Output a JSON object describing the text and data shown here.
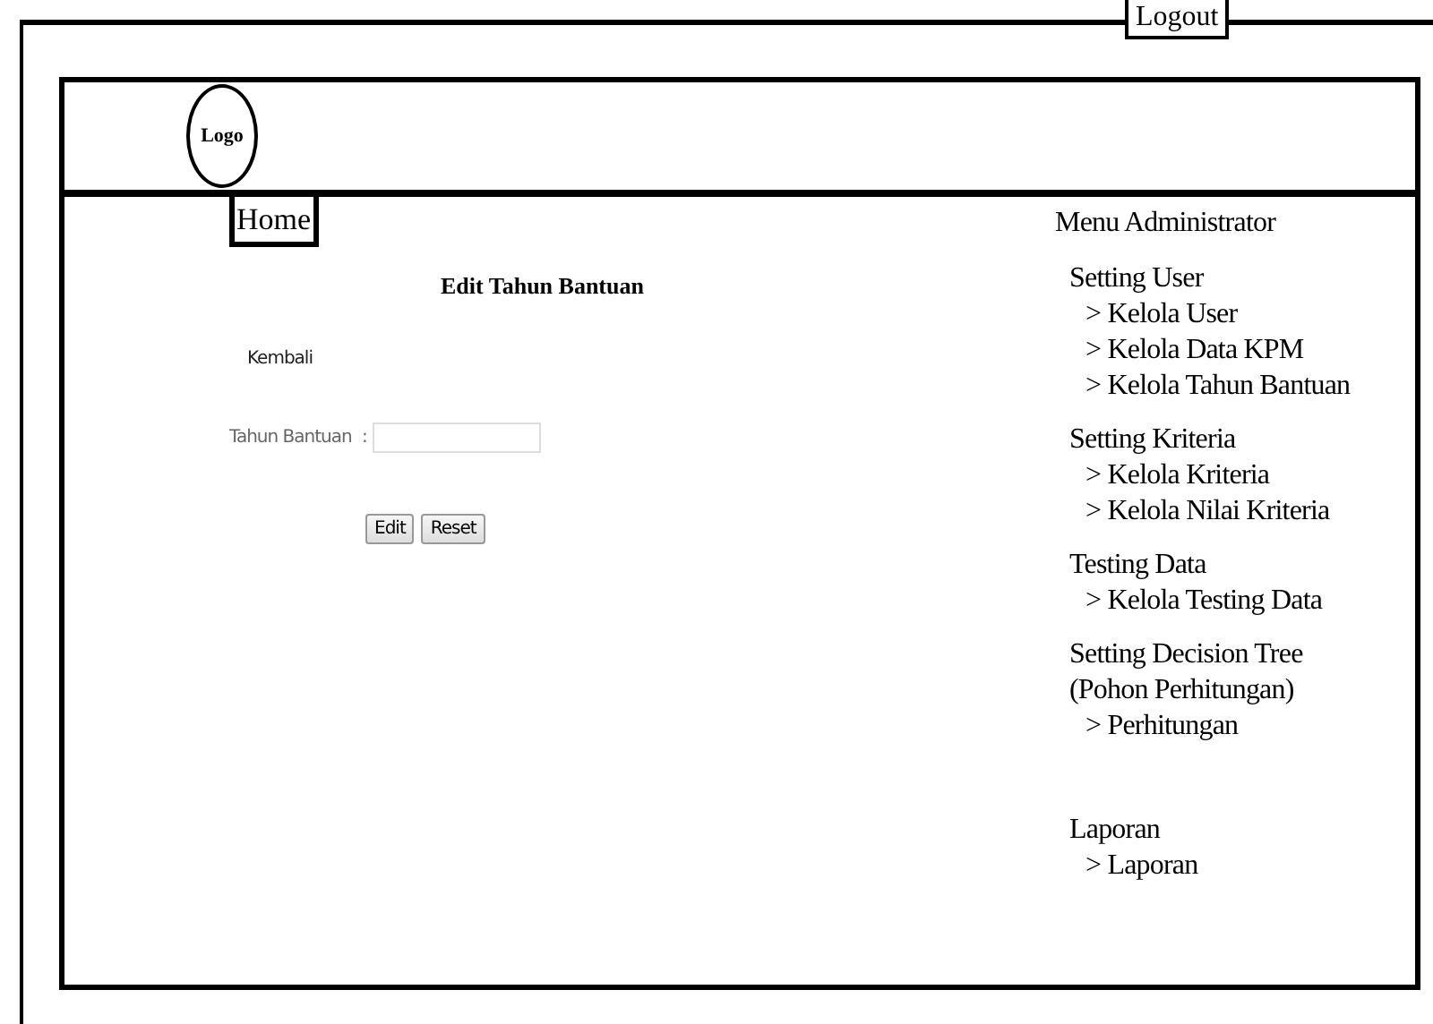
{
  "logout": "Logout",
  "logo": "Logo",
  "home": "Home",
  "form": {
    "title": "Edit Tahun Bantuan",
    "back_link": "Kembali",
    "fields": [
      {
        "label": "Tahun Bantuan",
        "separator": ":"
      }
    ],
    "buttons": [
      "Edit",
      "Reset"
    ]
  },
  "menu": {
    "title": "Menu Administrator",
    "groups": [
      {
        "title": "Setting User",
        "items": [
          "> Kelola User",
          "> Kelola Data KPM",
          "> Kelola Tahun Bantuan"
        ]
      },
      {
        "title": "Setting Kriteria",
        "items": [
          "> Kelola Kriteria",
          "> Kelola Nilai Kriteria"
        ]
      },
      {
        "title": "Testing Data",
        "items": [
          "> Kelola Testing Data"
        ]
      },
      {
        "title": "Setting Decision Tree (Pohon Perhitungan)",
        "items": [
          "> Perhitungan"
        ]
      },
      {
        "title": "Laporan",
        "items": [
          "> Laporan"
        ]
      }
    ]
  }
}
